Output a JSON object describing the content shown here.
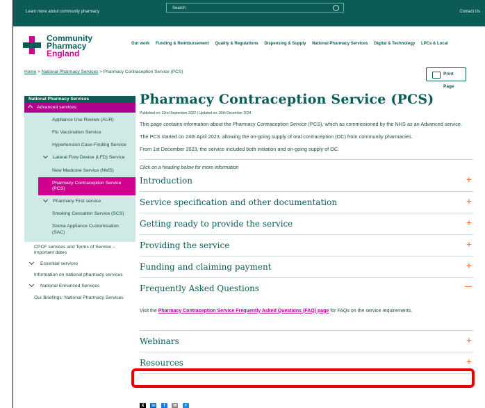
{
  "topbar": {
    "learn_more": "Learn more about community pharmacy",
    "search_placeholder": "Search",
    "contact": "Contact Us"
  },
  "logo": {
    "line1": "Community",
    "line2": "Pharmacy",
    "line3": "England"
  },
  "nav": [
    "Our work",
    "Funding & Reimbursement",
    "Quality & Regulations",
    "Dispensing & Supply",
    "National Pharmacy Services",
    "Digital & Technology",
    "LPCs & Local"
  ],
  "breadcrumb": {
    "home": "Home",
    "sep": ">",
    "section": "National Pharmacy Services",
    "current": "Pharmacy Contraception Service (PCS)"
  },
  "print_label": "Print Page",
  "sidebar": {
    "heading": "National Pharmacy Services",
    "advanced": "Advanced services",
    "sub_items": [
      {
        "label": "Appliance Use Review (AUR)"
      },
      {
        "label": "Flu Vaccination Service"
      },
      {
        "label": "Hypertension Case-Finding Service"
      },
      {
        "label": "Lateral Flow Device (LFD) Service"
      },
      {
        "label": "New Medicine Service (NMS)"
      },
      {
        "label": "Pharmacy Contraception Service (PCS)"
      },
      {
        "label": "Pharmacy First service"
      },
      {
        "label": "Smoking Cessation Service (SCS)"
      },
      {
        "label": "Stoma Appliance Customisation (SAC)"
      }
    ],
    "lower_items": [
      {
        "label": "CPCF services and Terms of Service – Important dates"
      },
      {
        "label": "Essential services"
      },
      {
        "label": "Information on national pharmacy services"
      },
      {
        "label": "National Enhanced Services"
      },
      {
        "label": "Our Briefings: National Pharmacy Services"
      }
    ]
  },
  "main": {
    "title": "Pharmacy Contraception Service (PCS)",
    "meta": "Published on: 22nd September 2022  |  Updated on: 30th December 2024",
    "para1": "This page contains information about the Pharmacy Contraception Service (PCS), which as commissioned by the NHS as an Advanced service.",
    "para2": "The PCS started on 24th April 2023, allowing the on-going supply of oral contraception (OC) from community pharmacies.",
    "para3": "From 1st December 2023, the service included both initiation and on-going supply of OC.",
    "click_hint": "Click on a heading below for more information",
    "accordion": [
      "Introduction",
      "Service specification and other documentation",
      "Getting ready to provide the service",
      "Providing the service",
      "Funding and claiming payment",
      "Frequently Asked Questions",
      "Webinars",
      "Resources"
    ],
    "faq_pre": "Visit the ",
    "faq_link": "Pharmacy Contraception Service Frequently Asked Questions (FAQ) page",
    "faq_post": " for FAQs on the service requirements."
  },
  "colors": {
    "brand_teal": "#0b5c55",
    "brand_magenta": "#d2008f",
    "accent_orange": "#ff6a2d",
    "highlight_red": "#ee0000"
  }
}
